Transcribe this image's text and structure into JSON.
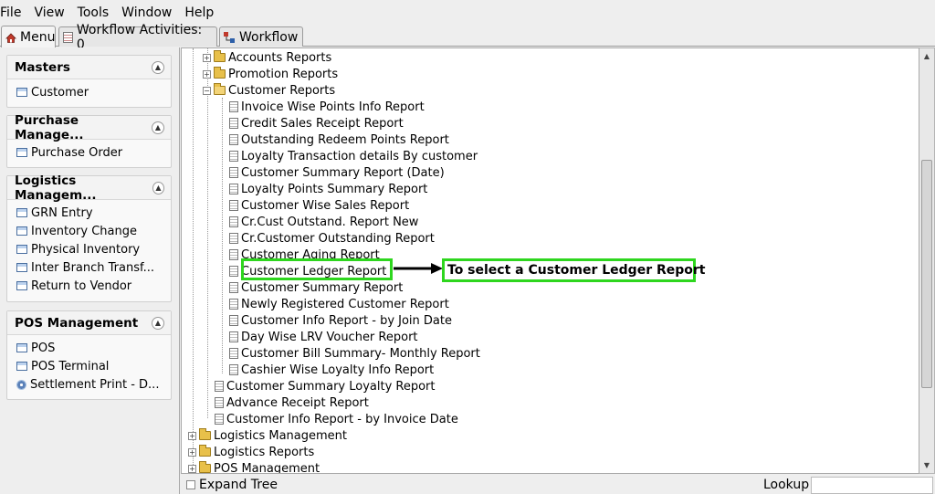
{
  "menubar": {
    "items": [
      "File",
      "View",
      "Tools",
      "Window",
      "Help"
    ]
  },
  "tabs": [
    {
      "label": "Menu",
      "icon": "home-icon"
    },
    {
      "label": "Workflow Activities: 0",
      "icon": "workflow-activities-icon"
    },
    {
      "label": "Workflow",
      "icon": "workflow-icon"
    }
  ],
  "sidebar": {
    "panels": [
      {
        "title": "Masters",
        "items": [
          "Customer"
        ]
      },
      {
        "title": "Purchase Manage...",
        "items": [
          "Purchase Order"
        ]
      },
      {
        "title": "Logistics Managem...",
        "items": [
          "GRN Entry",
          "Inventory Change",
          "Physical Inventory",
          "Inter Branch Transf...",
          "Return to Vendor"
        ]
      },
      {
        "title": "POS Management",
        "items": [
          "POS",
          "POS Terminal",
          "Settlement Print - D..."
        ]
      }
    ]
  },
  "tree": {
    "folders_top": [
      "Accounts Reports",
      "Promotion Reports",
      "Customer Reports"
    ],
    "customer_reports": [
      "Invoice Wise Points Info Report",
      "Credit Sales Receipt Report",
      "Outstanding Redeem Points Report",
      "Loyalty Transaction details By customer",
      "Customer Summary Report (Date)",
      "Loyalty Points Summary Report",
      "Customer Wise Sales Report",
      "Cr.Cust Outstand. Report New",
      "Cr.Customer Outstanding Report",
      "Customer Aging Report",
      "Customer Ledger Report",
      "Customer Summary Report",
      "Newly Registered Customer Report",
      "Customer Info Report - by Join Date",
      "Day Wise LRV Voucher Report",
      "Customer Bill Summary- Monthly Report",
      "Cashier Wise Loyalty Info Report"
    ],
    "level2_docs": [
      "Customer Summary Loyalty Report",
      "Advance Receipt Report",
      "Customer Info Report - by Invoice Date"
    ],
    "level1_folders": [
      "Logistics Management",
      "Logistics Reports",
      "POS Management"
    ]
  },
  "annotation": {
    "text": "To select a Customer Ledger Report"
  },
  "bottom": {
    "expand_tree": "Expand Tree",
    "lookup": "Lookup"
  }
}
